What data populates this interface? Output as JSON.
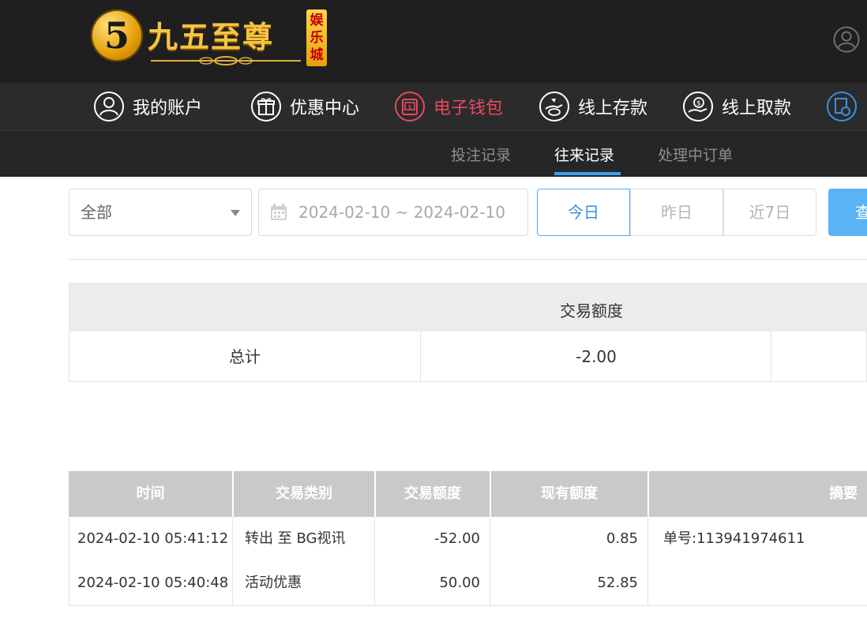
{
  "header": {
    "logo_text": "九五至尊",
    "logo_badge": "娱乐城",
    "logo_mark": "5"
  },
  "nav": {
    "items": [
      {
        "label": "我的账户",
        "icon": "user-circle-icon",
        "active": false
      },
      {
        "label": "优惠中心",
        "icon": "gift-icon",
        "active": false
      },
      {
        "label": "电子钱包",
        "icon": "wallet-icon",
        "active": true
      },
      {
        "label": "线上存款",
        "icon": "deposit-icon",
        "active": false
      },
      {
        "label": "线上取款",
        "icon": "withdraw-icon",
        "active": false
      }
    ],
    "active_color": "#e8485f"
  },
  "subnav": {
    "tabs": [
      {
        "label": "投注记录",
        "active": false
      },
      {
        "label": "往来记录",
        "active": true
      },
      {
        "label": "处理中订单",
        "active": false
      }
    ],
    "accent": "#3aa0f0"
  },
  "filters": {
    "type_select": "全部",
    "date_range": "2024-02-10 ~ 2024-02-10",
    "quick_today": "今日",
    "quick_yesterday": "昨日",
    "quick_week": "近7日",
    "query_button": "查"
  },
  "summary": {
    "header": "交易额度",
    "total_label": "总计",
    "total_value": "-2.00"
  },
  "transactions": {
    "columns": [
      "时间",
      "交易类别",
      "交易额度",
      "现有额度",
      "摘要"
    ],
    "rows": [
      {
        "time": "2024-02-10 05:41:12",
        "type": "转出 至 BG视讯",
        "amount": "-52.00",
        "balance": "0.85",
        "note": "单号:113941974611"
      },
      {
        "time": "2024-02-10 05:40:48",
        "type": "活动优惠",
        "amount": "50.00",
        "balance": "52.85",
        "note": ""
      }
    ]
  }
}
